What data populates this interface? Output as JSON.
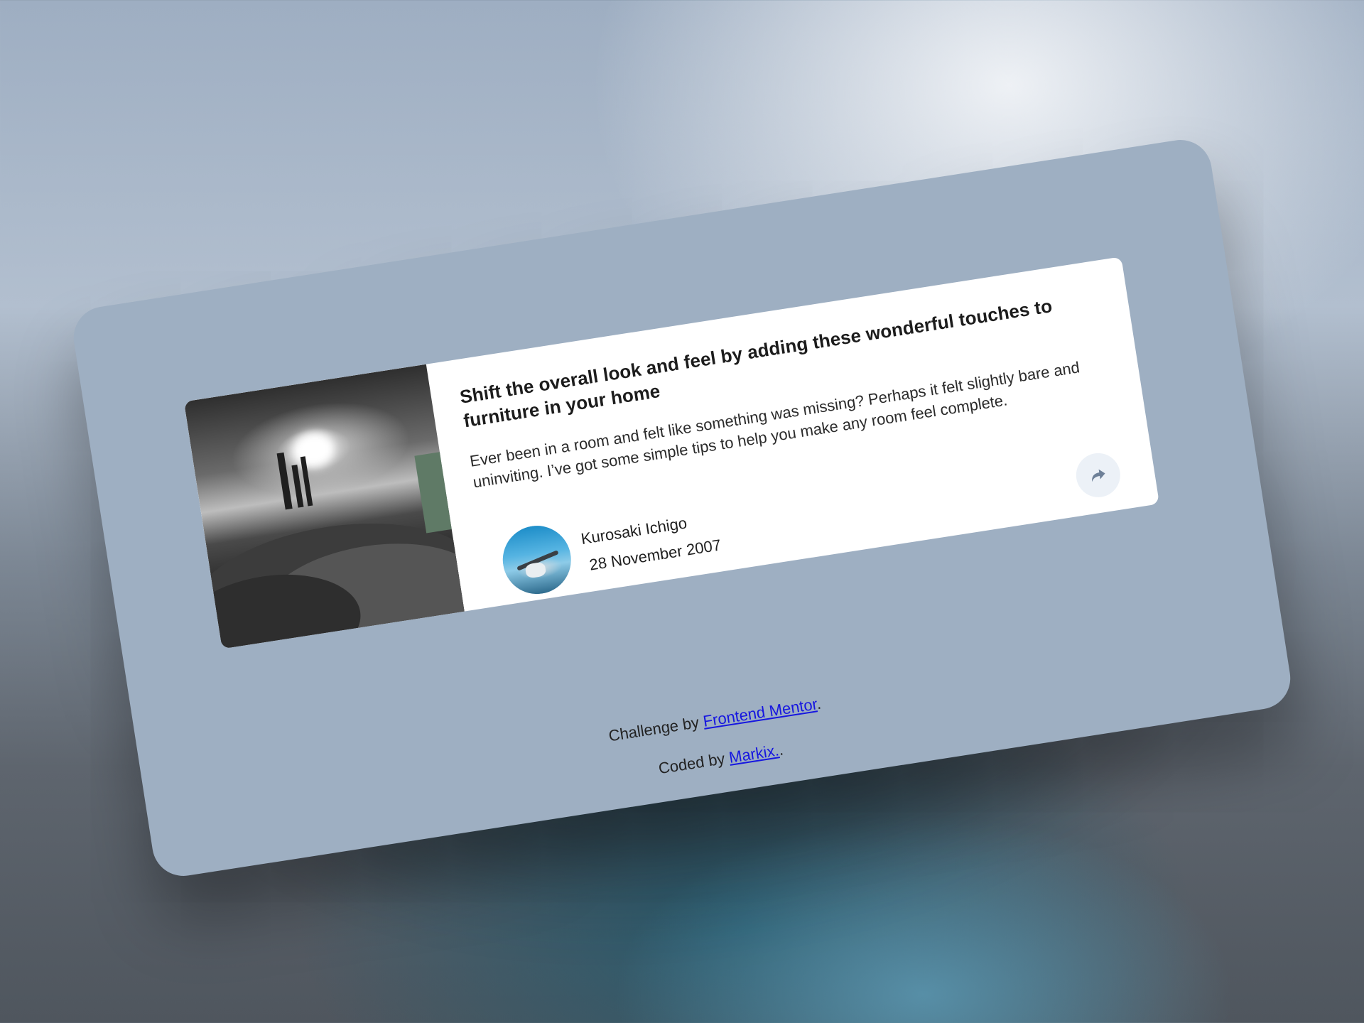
{
  "article": {
    "title": "Shift the overall look and feel by adding these wonderful touches to furniture in your home",
    "excerpt": "Ever been in a room and felt like something was missing? Perhaps it felt slightly bare and uninviting. I’ve got some simple tips to help you make any room feel complete.",
    "author_name": "Kurosaki Ichigo",
    "date": "28 November 2007",
    "share_icon": "share-icon"
  },
  "footer": {
    "challenge_prefix": "Challenge by ",
    "challenge_link": "Frontend Mentor",
    "challenge_suffix": ".",
    "coded_prefix": "Coded by ",
    "coded_link": "Markix.",
    "coded_suffix": "."
  },
  "colors": {
    "panel_background": "#9eafc2",
    "card_background": "#ffffff",
    "share_button_background": "#ecf1f7",
    "link": "#1616e0"
  }
}
